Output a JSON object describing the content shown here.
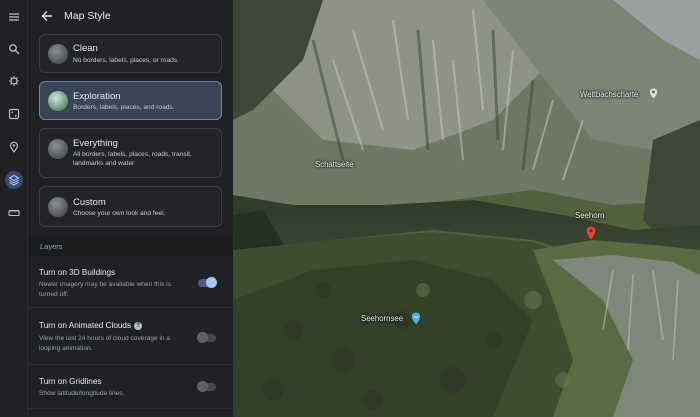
{
  "panel": {
    "title": "Map Style",
    "styles": [
      {
        "name": "Clean",
        "desc": "No borders, labels, places, or roads."
      },
      {
        "name": "Exploration",
        "desc": "Borders, labels, places, and roads."
      },
      {
        "name": "Everything",
        "desc": "All borders, labels, places, roads, transit, landmarks and water."
      },
      {
        "name": "Custom",
        "desc": "Choose your own look and feel."
      }
    ],
    "selected_style": "Exploration",
    "layers_heading": "Layers",
    "layers": [
      {
        "name": "Turn on 3D Buildings",
        "desc": "Newer imagery may be available when this is turned off.",
        "enabled": true
      },
      {
        "name": "Turn on Animated Clouds",
        "desc": "View the last 24 hours of cloud coverage in a looping animation.",
        "enabled": false
      },
      {
        "name": "Turn on Gridlines",
        "desc": "Show latitude/longitude lines.",
        "enabled": false
      }
    ]
  },
  "rail_icons": [
    "menu-icon",
    "search-icon",
    "voyager-icon",
    "feeling-lucky-icon",
    "projects-icon",
    "map-style-icon",
    "measure-icon"
  ],
  "map": {
    "labels": {
      "wettbachscharte": "Wettbachscharte",
      "schattseite": "Schattseite",
      "seehorn": "Seehorn",
      "seehornsee": "Seehornsee"
    }
  },
  "colors": {
    "accent": "#a8c7fa",
    "selected_card": "#394457",
    "panel_bg": "#202124",
    "pin_red": "#ea4335",
    "pin_blue": "#4fb3d9"
  }
}
